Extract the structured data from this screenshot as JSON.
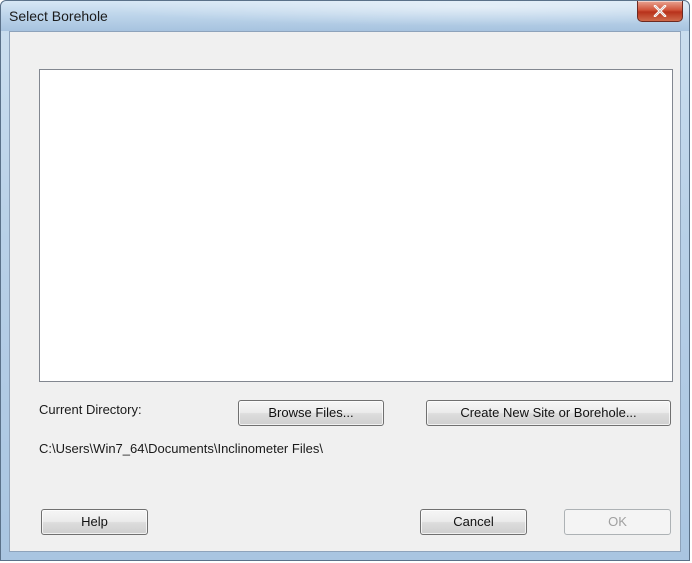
{
  "window": {
    "title": "Select Borehole"
  },
  "borehole_list": {
    "items": []
  },
  "directory": {
    "label": "Current Directory:",
    "path": "C:\\Users\\Win7_64\\Documents\\Inclinometer Files\\"
  },
  "buttons": {
    "browse": "Browse Files...",
    "create": "Create New Site or Borehole...",
    "help": "Help",
    "cancel": "Cancel",
    "ok": "OK"
  },
  "colors": {
    "frame": "#b9d1e8",
    "close_button": "#c74a2f",
    "client_background": "#f0f0f0"
  }
}
